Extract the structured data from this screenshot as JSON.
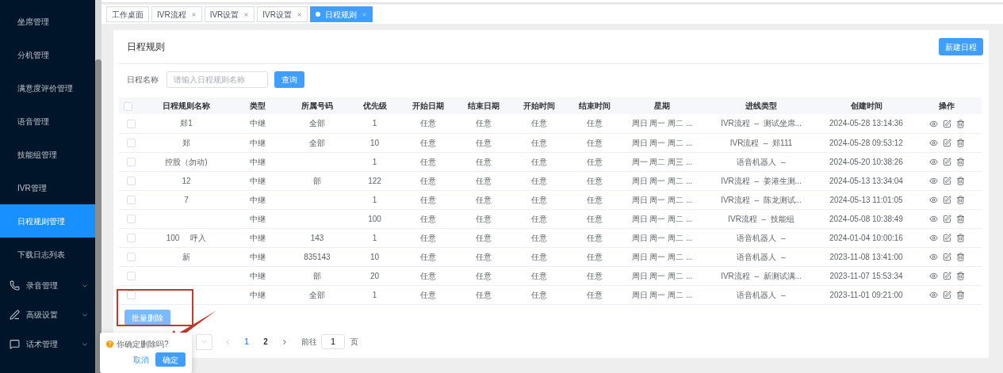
{
  "sidebar": {
    "items": [
      {
        "label": "坐席管理",
        "kind": "link",
        "selected": false
      },
      {
        "label": "分机管理",
        "kind": "link",
        "selected": false
      },
      {
        "label": "满意度评价管理",
        "kind": "link",
        "selected": false
      },
      {
        "label": "语音管理",
        "kind": "link",
        "selected": false
      },
      {
        "label": "技能组管理",
        "kind": "link",
        "selected": false
      },
      {
        "label": "IVR管理",
        "kind": "link",
        "selected": false
      },
      {
        "label": "日程规则管理",
        "kind": "link",
        "selected": true
      },
      {
        "label": "下载日志列表",
        "kind": "link",
        "selected": false
      },
      {
        "label": "录音管理",
        "kind": "group",
        "selected": false
      },
      {
        "label": "高级设置",
        "kind": "group",
        "selected": false
      },
      {
        "label": "话术管理",
        "kind": "group",
        "selected": false
      }
    ]
  },
  "tabs": [
    {
      "label": "工作桌面",
      "selected": false,
      "closable": false
    },
    {
      "label": "IVR流程",
      "selected": false,
      "closable": true
    },
    {
      "label": "IVR设置",
      "selected": false,
      "closable": true
    },
    {
      "label": "IVR设置",
      "selected": false,
      "closable": true
    },
    {
      "label": "日程规则",
      "selected": true,
      "closable": true
    }
  ],
  "page": {
    "title": "日程规则",
    "new_button": "新建日程",
    "search": {
      "label": "日程名称",
      "placeholder": "请输入日程规则名称",
      "button": "查询"
    },
    "table": {
      "header_checked": false,
      "columns": [
        "日程规则名称",
        "类型",
        "所属号码",
        "优先级",
        "开始日期",
        "结束日期",
        "开始时间",
        "结束时间",
        "星期",
        "进线类型",
        "创建时间",
        "操作"
      ],
      "rows": [
        {
          "checked": false,
          "cells": [
            "郑1",
            "中继",
            "全部",
            "1",
            "任意",
            "任意",
            "任意",
            "任意",
            "周日 周一 周二 ...",
            "IVR流程  –  测试坐席...",
            "2024-05-28 13:14:36"
          ]
        },
        {
          "checked": false,
          "cells": [
            "郑",
            "中继",
            "全部",
            "10",
            "任意",
            "任意",
            "任意",
            "任意",
            "周日 周一 周二 ...",
            "IVR流程  –  郑111",
            "2024-05-28 09:53:12"
          ]
        },
        {
          "checked": false,
          "cells": [
            "控股（勿动)",
            "中继",
            "",
            "1",
            "任意",
            "任意",
            "任意",
            "任意",
            "周一 周二 周三 ...",
            "语音机器人  –",
            "2024-05-20 10:38:26"
          ]
        },
        {
          "checked": false,
          "cells": [
            "12",
            "中继",
            "部",
            "122",
            "任意",
            "任意",
            "任意",
            "任意",
            "周日 周一 周二 ...",
            "IVR流程  –  姜港生测...",
            "2024-05-13 13:34:04"
          ]
        },
        {
          "checked": false,
          "cells": [
            "7",
            "中继",
            "",
            "1",
            "任意",
            "任意",
            "任意",
            "任意",
            "周日 周一 周二 ...",
            "IVR流程  –  陈龙测试...",
            "2024-05-13 11:01:05"
          ]
        },
        {
          "checked": false,
          "cells": [
            "",
            "中继",
            "",
            "100",
            "任意",
            "任意",
            "任意",
            "任意",
            "周日 周一 周二 ...",
            "IVR流程  –  技能组",
            "2024-05-08 10:38:49"
          ]
        },
        {
          "checked": false,
          "cells": [
            "100     呼入",
            "中继",
            "143",
            "1",
            "任意",
            "任意",
            "任意",
            "任意",
            "周日 周一 周二 ...",
            "语音机器人  –",
            "2024-01-04 10:00:16"
          ]
        },
        {
          "checked": false,
          "cells": [
            "新",
            "中继",
            "835143",
            "10",
            "任意",
            "任意",
            "任意",
            "任意",
            "周日 周一 周二 ...",
            "语音机器人  –",
            "2023-11-08 13:41:00"
          ]
        },
        {
          "checked": false,
          "cells": [
            "",
            "中继",
            "部",
            "20",
            "任意",
            "任意",
            "任意",
            "任意",
            "周日 周一 周二 ...",
            "IVR流程  –  新测试满...",
            "2023-11-07 15:53:34"
          ]
        },
        {
          "checked": false,
          "cells": [
            "",
            "中继",
            "全部",
            "1",
            "任意",
            "任意",
            "任意",
            "任意",
            "周日 周一 周二 ...",
            "语音机器人  –",
            "2023-11-01 09:21:00"
          ]
        }
      ]
    },
    "batch_delete": "批量删除",
    "pagination": {
      "pages": [
        {
          "label": "1",
          "selected": true
        },
        {
          "label": "2",
          "selected": false
        }
      ],
      "goto_label": "前往",
      "goto_value": "1",
      "goto_suffix": "页"
    },
    "popconfirm": {
      "message": "你确定删除吗?",
      "cancel": "取消",
      "confirm": "确定"
    }
  }
}
